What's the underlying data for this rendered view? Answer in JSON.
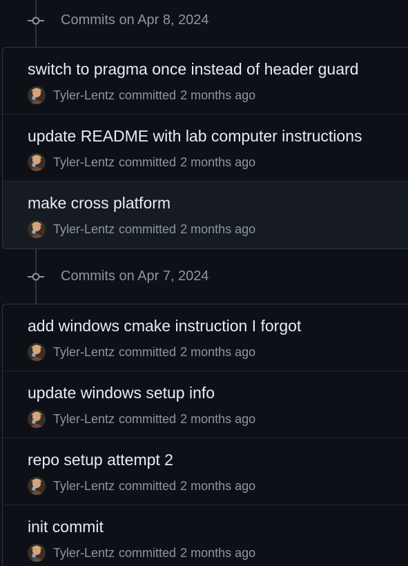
{
  "groups": [
    {
      "title": "Commits on Apr 8, 2024",
      "commits": [
        {
          "message": "switch to pragma once instead of header guard",
          "author": "Tyler-Lentz",
          "action": "committed",
          "time": "2 months ago"
        },
        {
          "message": "update README with lab computer instructions",
          "author": "Tyler-Lentz",
          "action": "committed",
          "time": "2 months ago"
        },
        {
          "message": "make cross platform",
          "author": "Tyler-Lentz",
          "action": "committed",
          "time": "2 months ago"
        }
      ]
    },
    {
      "title": "Commits on Apr 7, 2024",
      "commits": [
        {
          "message": "add windows cmake instruction I forgot",
          "author": "Tyler-Lentz",
          "action": "committed",
          "time": "2 months ago"
        },
        {
          "message": "update windows setup info",
          "author": "Tyler-Lentz",
          "action": "committed",
          "time": "2 months ago"
        },
        {
          "message": "repo setup attempt 2",
          "author": "Tyler-Lentz",
          "action": "committed",
          "time": "2 months ago"
        },
        {
          "message": "init commit",
          "author": "Tyler-Lentz",
          "action": "committed",
          "time": "2 months ago"
        }
      ]
    }
  ],
  "colors": {
    "background": "#0d1117",
    "border": "#30363d",
    "muted_text": "#8d96a0",
    "primary_text": "#e6edf3",
    "hover_row": "#161b22"
  },
  "icons": {
    "group_node": "git-commit-icon",
    "avatar": "user-avatar"
  }
}
